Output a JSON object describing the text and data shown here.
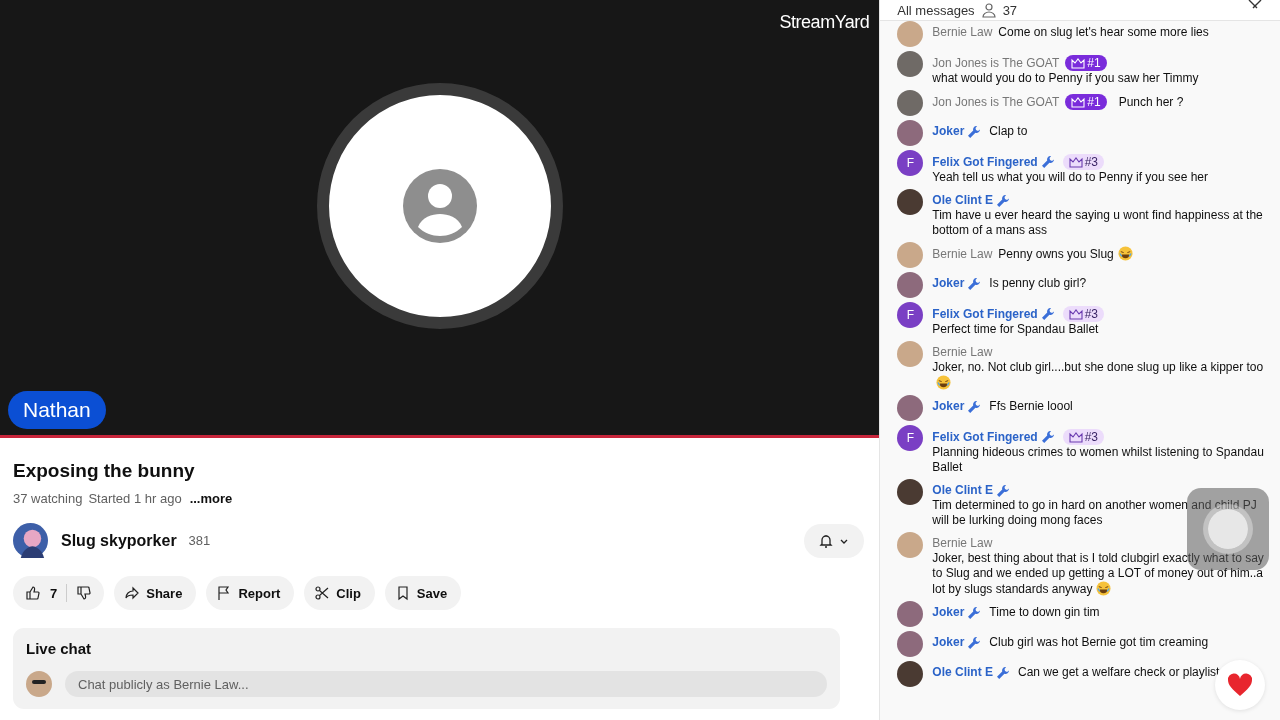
{
  "video": {
    "logo": "StreamYard",
    "speaker": "Nathan"
  },
  "title": "Exposing the bunny",
  "meta": {
    "watching": "37 watching",
    "started": "Started 1 hr ago",
    "more": "...more"
  },
  "channel": {
    "name": "Slug skyporker",
    "subscribers": "381"
  },
  "actions": [
    {
      "kind": "like",
      "label": "7"
    },
    {
      "kind": "share",
      "label": "Share"
    },
    {
      "kind": "report",
      "label": "Report"
    },
    {
      "kind": "clip",
      "label": "Clip"
    },
    {
      "kind": "save",
      "label": "Save"
    }
  ],
  "live_chat": {
    "title": "Live chat",
    "placeholder": "Chat publicly as Bernie Law..."
  },
  "chat": {
    "filter": "All messages",
    "viewers": "37",
    "messages": [
      {
        "author": "Bernie Law",
        "moderator": false,
        "color": "#c9a88a",
        "text": "Come on slug let's hear some more lies",
        "emoji": false
      },
      {
        "author": "Jon Jones is The GOAT",
        "moderator": false,
        "color": "#6f6a66",
        "badge": "#1",
        "badge_top": true,
        "text": "what would you do to Penny if you saw her Timmy",
        "emoji": false
      },
      {
        "author": "Jon Jones is The GOAT",
        "moderator": false,
        "color": "#6f6a66",
        "badge": "#1",
        "badge_top": true,
        "text": "Punch her ?",
        "emoji": false
      },
      {
        "author": "Joker",
        "moderator": true,
        "color": "#8d6a7c",
        "text": "Clap to",
        "emoji": false
      },
      {
        "author": "Felix Got Fingered",
        "moderator": true,
        "color": "#7a3fc4",
        "initial": "F",
        "badge": "#3",
        "badge_top": false,
        "text": "Yeah tell us what you will do to Penny if you see her",
        "emoji": false
      },
      {
        "author": "Ole Clint E",
        "moderator": true,
        "color": "#4a3a32",
        "text": "Tim have u ever heard the saying u wont find happiness at the bottom of a mans ass",
        "emoji": false
      },
      {
        "author": "Bernie Law",
        "moderator": false,
        "color": "#c9a88a",
        "text": "Penny owns you Slug",
        "emoji": true
      },
      {
        "author": "Joker",
        "moderator": true,
        "color": "#8d6a7c",
        "text": "Is penny club girl?",
        "emoji": false
      },
      {
        "author": "Felix Got Fingered",
        "moderator": true,
        "color": "#7a3fc4",
        "initial": "F",
        "badge": "#3",
        "badge_top": false,
        "text": "Perfect time for Spandau Ballet",
        "emoji": false
      },
      {
        "author": "Bernie Law",
        "moderator": false,
        "color": "#c9a88a",
        "text": "Joker, no. Not club girl....but she done slug up like a kipper too",
        "emoji": true
      },
      {
        "author": "Joker",
        "moderator": true,
        "color": "#8d6a7c",
        "text": "Ffs Bernie loool",
        "emoji": false
      },
      {
        "author": "Felix Got Fingered",
        "moderator": true,
        "color": "#7a3fc4",
        "initial": "F",
        "badge": "#3",
        "badge_top": false,
        "text": "Planning hideous crimes to women whilst listening to Spandau Ballet",
        "emoji": false
      },
      {
        "author": "Ole Clint E",
        "moderator": true,
        "color": "#4a3a32",
        "text": "Tim determined to go in hard on another women and child PJ will be lurking doing mong faces",
        "emoji": false
      },
      {
        "author": "Bernie Law",
        "moderator": false,
        "color": "#c9a88a",
        "text": "Joker, best thing about that is I told clubgirl exactly what to say to Slug and we ended up getting a LOT of money out of him..a lot by slugs standards anyway",
        "emoji": true
      },
      {
        "author": "Joker",
        "moderator": true,
        "color": "#8d6a7c",
        "text": "Time to down gin tim",
        "emoji": false
      },
      {
        "author": "Joker",
        "moderator": true,
        "color": "#8d6a7c",
        "text": "Club girl was hot Bernie got tim creaming",
        "emoji": false
      },
      {
        "author": "Ole Clint E",
        "moderator": true,
        "color": "#4a3a32",
        "text": "Can we get a welfare check or playlist",
        "emoji": false
      }
    ]
  }
}
